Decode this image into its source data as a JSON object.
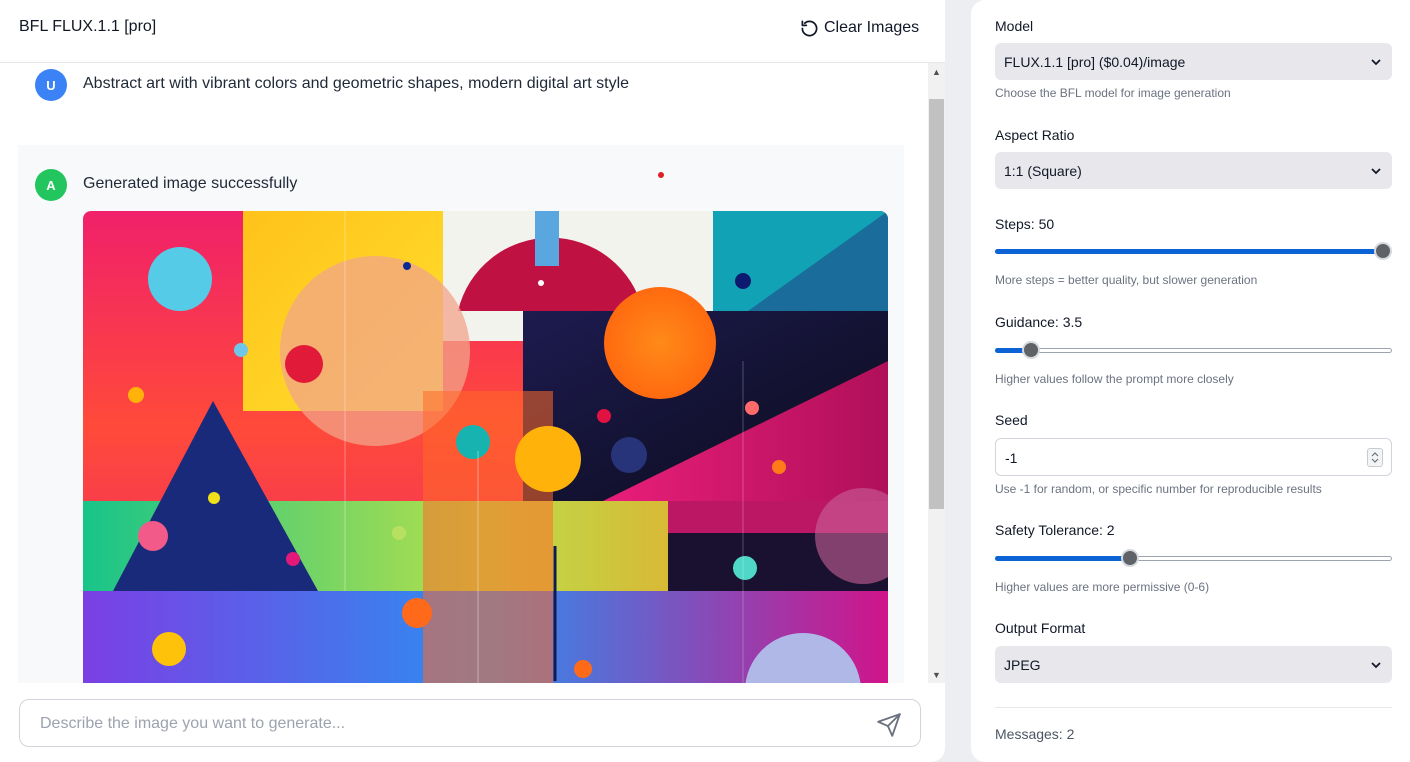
{
  "header": {
    "title": "BFL FLUX.1.1 [pro]",
    "clear_label": "Clear Images"
  },
  "messages": [
    {
      "role": "user",
      "avatar": "U",
      "avatar_color": "#3b82f6",
      "text": "Abstract art with vibrant colors and geometric shapes, modern digital art style"
    },
    {
      "role": "assistant",
      "avatar": "A",
      "avatar_color": "#22c55e",
      "text": "Generated image successfully",
      "image_alt": "Abstract colorful geometric artwork with circles, triangles and color blocks"
    }
  ],
  "composer": {
    "placeholder": "Describe the image you want to generate...",
    "value": "",
    "send_icon": "send-icon"
  },
  "settings": {
    "model": {
      "label": "Model",
      "value": "FLUX.1.1 [pro] ($0.04)/image",
      "hint": "Choose the BFL model for image generation"
    },
    "aspect_ratio": {
      "label": "Aspect Ratio",
      "value": "1:1 (Square)"
    },
    "steps": {
      "label": "Steps: 50",
      "value": 50,
      "min": 1,
      "max": 50,
      "hint": "More steps = better quality, but slower generation"
    },
    "guidance": {
      "label": "Guidance: 3.5",
      "value": 3.5,
      "min": 1.5,
      "max": 30,
      "hint": "Higher values follow the prompt more closely"
    },
    "seed": {
      "label": "Seed",
      "value": "-1",
      "hint": "Use -1 for random, or specific number for reproducible results"
    },
    "safety": {
      "label": "Safety Tolerance: 2",
      "value": 2,
      "min": 0,
      "max": 6,
      "hint": "Higher values are more permissive (0-6)"
    },
    "output_format": {
      "label": "Output Format",
      "value": "JPEG"
    }
  },
  "footer": {
    "messages_count": "Messages: 2"
  },
  "colors": {
    "accent": "#0b63d6",
    "user_avatar": "#3b82f6",
    "assistant_avatar": "#22c55e",
    "slider_thumb": "#5f6368"
  }
}
